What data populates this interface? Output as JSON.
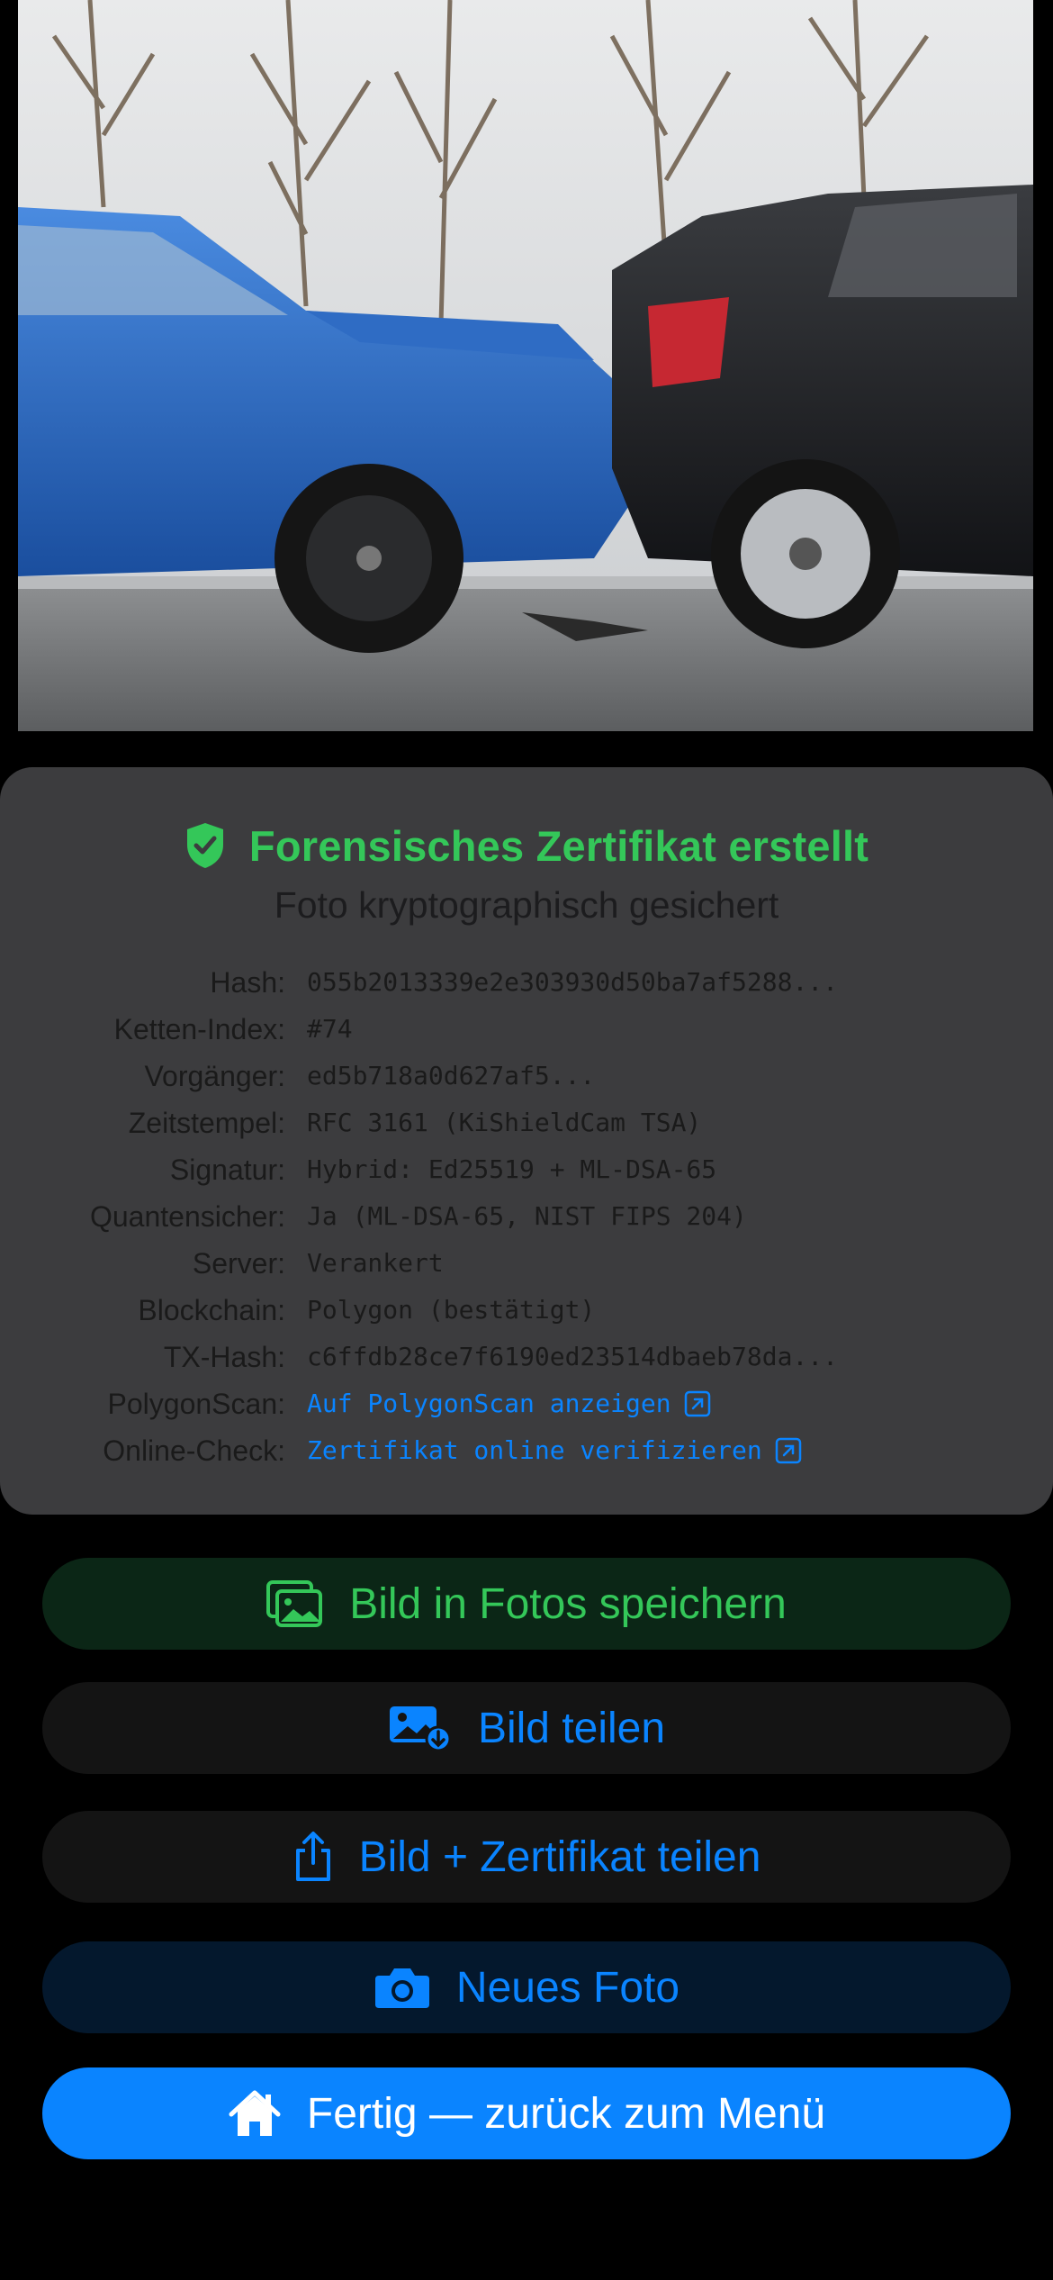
{
  "photo": {
    "subject": "car-collision-photo"
  },
  "certificate": {
    "title": "Forensisches Zertifikat erstellt",
    "subtitle": "Foto kryptographisch gesichert",
    "rows": [
      {
        "key": "Hash:",
        "value": "055b2013339e2e303930d50ba7af5288..."
      },
      {
        "key": "Ketten-Index:",
        "value": "#74"
      },
      {
        "key": "Vorgänger:",
        "value": "ed5b718a0d627af5..."
      },
      {
        "key": "Zeitstempel:",
        "value": "RFC 3161 (KiShieldCam TSA)"
      },
      {
        "key": "Signatur:",
        "value": "Hybrid: Ed25519 + ML-DSA-65"
      },
      {
        "key": "Quantensicher:",
        "value": "Ja (ML-DSA-65, NIST FIPS 204)"
      },
      {
        "key": "Server:",
        "value": "Verankert"
      },
      {
        "key": "Blockchain:",
        "value": "Polygon (bestätigt)"
      },
      {
        "key": "TX-Hash:",
        "value": "c6ffdb28ce7f6190ed23514dbaeb78da..."
      },
      {
        "key": "PolygonScan:",
        "value": "Auf PolygonScan anzeigen"
      },
      {
        "key": "Online-Check:",
        "value": "Zertifikat online verifizieren"
      }
    ]
  },
  "buttons": {
    "save_photos": "Bild in Fotos speichern",
    "share_image": "Bild teilen",
    "share_image_cert": "Bild + Zertifikat teilen",
    "new_photo": "Neues Foto",
    "done": "Fertig — zurück zum Menü"
  },
  "colors": {
    "accent_green": "#34c759",
    "accent_blue": "#0a84ff",
    "card_bg": "#3c3c3e",
    "background": "#000000"
  },
  "icons": [
    "shield-check-icon",
    "external-link-icon",
    "photos-stack-icon",
    "photo-download-icon",
    "share-icon",
    "camera-icon",
    "house-icon"
  ]
}
